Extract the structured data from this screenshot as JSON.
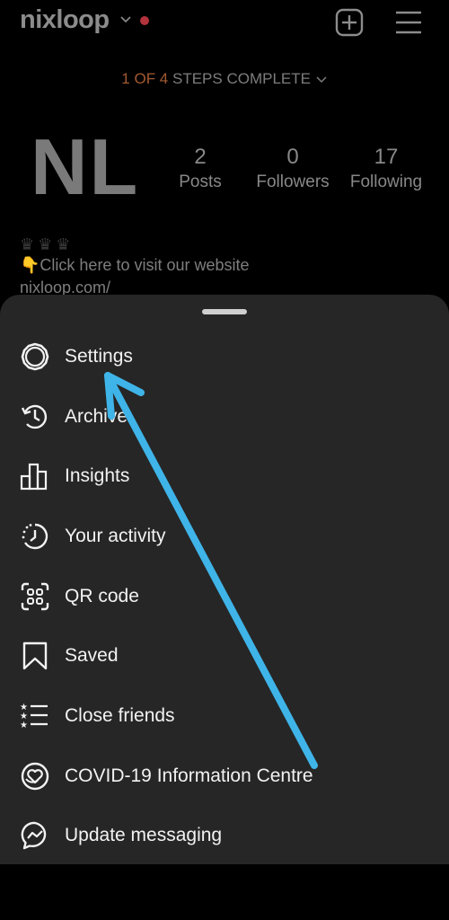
{
  "header": {
    "username": "nixloop",
    "notification_dot_color": "#b3333c",
    "add_icon": "plus-square-icon",
    "menu_icon": "hamburger-menu-icon"
  },
  "steps": {
    "highlight": "1 OF 4",
    "rest": " STEPS COMPLETE",
    "highlight_color": "#a25a32"
  },
  "profile": {
    "avatar_initials": "NL",
    "stats": [
      {
        "value": "2",
        "label": "Posts"
      },
      {
        "value": "0",
        "label": "Followers"
      },
      {
        "value": "17",
        "label": "Following"
      }
    ],
    "bio_crowns": "♛♛♛",
    "bio_hand": "👇",
    "bio_text": "Click here to visit our website",
    "bio_link": "nixloop.com/"
  },
  "sheet": {
    "items": [
      {
        "label": "Settings",
        "icon": "settings-icon"
      },
      {
        "label": "Archive",
        "icon": "archive-icon"
      },
      {
        "label": "Insights",
        "icon": "insights-icon"
      },
      {
        "label": "Your activity",
        "icon": "activity-icon"
      },
      {
        "label": "QR code",
        "icon": "qr-code-icon"
      },
      {
        "label": "Saved",
        "icon": "bookmark-icon"
      },
      {
        "label": "Close friends",
        "icon": "close-friends-icon"
      },
      {
        "label": "COVID-19 Information Centre",
        "icon": "covid-info-icon"
      },
      {
        "label": "Update messaging",
        "icon": "messenger-icon"
      }
    ]
  },
  "annotation": {
    "arrow_color": "#3fb4e8",
    "points_to": "Settings"
  }
}
